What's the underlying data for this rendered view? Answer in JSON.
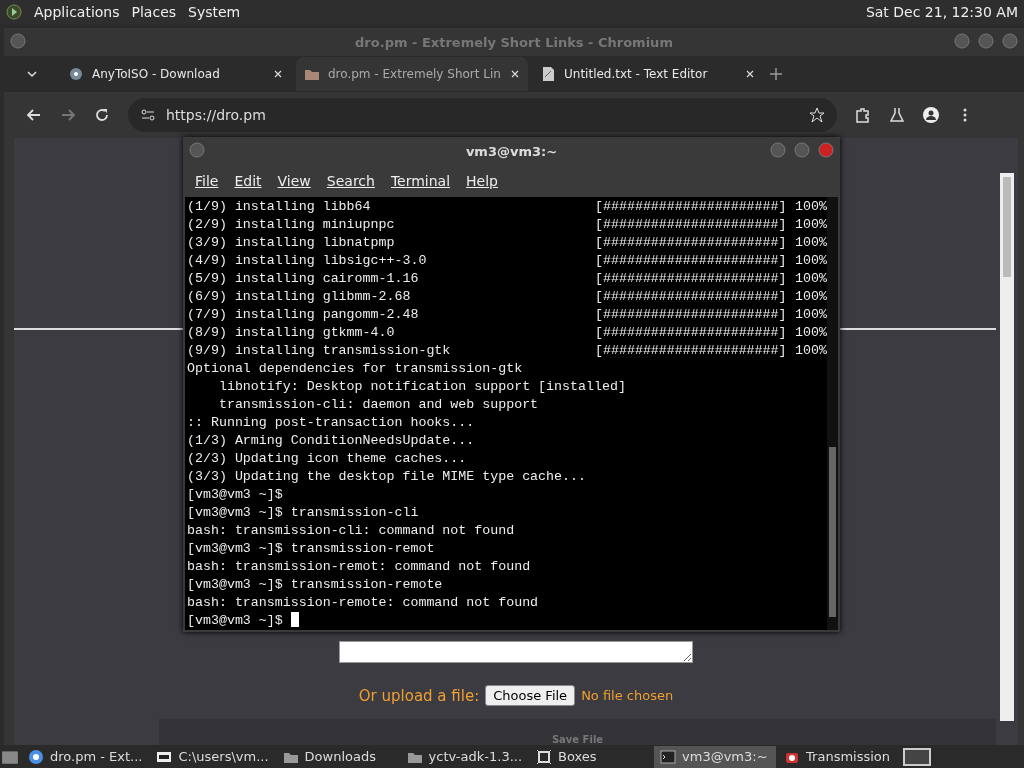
{
  "top_panel": {
    "menus": [
      "Applications",
      "Places",
      "System"
    ],
    "clock": "Sat Dec 21, 12:30 AM"
  },
  "browser": {
    "title": "dro.pm - Extremely Short Links - Chromium",
    "tabs": [
      {
        "label": "AnyToISO - Download",
        "selected": false
      },
      {
        "label": "dro.pm - Extremely Short Lin",
        "selected": true
      },
      {
        "label": "Untitled.txt - Text Editor",
        "selected": false
      }
    ],
    "url": "https://dro.pm",
    "page": {
      "upload_label": "Or upload a file:",
      "choose_button": "Choose File",
      "file_status": "No file chosen",
      "save_bar": "Save File"
    }
  },
  "terminal": {
    "title": "vm3@vm3:~",
    "menus": [
      "File",
      "Edit",
      "View",
      "Search",
      "Terminal",
      "Help"
    ],
    "lines": [
      {
        "text": "(1/9) installing libb64",
        "bar": "[######################]",
        "percent": "100%"
      },
      {
        "text": "(2/9) installing miniupnpc",
        "bar": "[######################]",
        "percent": "100%"
      },
      {
        "text": "(3/9) installing libnatpmp",
        "bar": "[######################]",
        "percent": "100%"
      },
      {
        "text": "(4/9) installing libsigc++-3.0",
        "bar": "[######################]",
        "percent": "100%"
      },
      {
        "text": "(5/9) installing cairomm-1.16",
        "bar": "[######################]",
        "percent": "100%"
      },
      {
        "text": "(6/9) installing glibmm-2.68",
        "bar": "[######################]",
        "percent": "100%"
      },
      {
        "text": "(7/9) installing pangomm-2.48",
        "bar": "[######################]",
        "percent": "100%"
      },
      {
        "text": "(8/9) installing gtkmm-4.0",
        "bar": "[######################]",
        "percent": "100%"
      },
      {
        "text": "(9/9) installing transmission-gtk",
        "bar": "[######################]",
        "percent": "100%"
      },
      {
        "text": "Optional dependencies for transmission-gtk"
      },
      {
        "text": "    libnotify: Desktop notification support [installed]"
      },
      {
        "text": "    transmission-cli: daemon and web support"
      },
      {
        "text": ":: Running post-transaction hooks..."
      },
      {
        "text": "(1/3) Arming ConditionNeedsUpdate..."
      },
      {
        "text": "(2/3) Updating icon theme caches..."
      },
      {
        "text": "(3/3) Updating the desktop file MIME type cache..."
      },
      {
        "text": "[vm3@vm3 ~]$"
      },
      {
        "text": "[vm3@vm3 ~]$ transmission-cli"
      },
      {
        "text": "bash: transmission-cli: command not found"
      },
      {
        "text": "[vm3@vm3 ~]$ transmission-remot"
      },
      {
        "text": "bash: transmission-remot: command not found"
      },
      {
        "text": "[vm3@vm3 ~]$ transmission-remote"
      },
      {
        "text": "bash: transmission-remote: command not found"
      },
      {
        "text": "[vm3@vm3 ~]$",
        "cursor": true
      }
    ]
  },
  "taskbar": [
    {
      "label": "dro.pm - Ext...",
      "kind": "browser",
      "selected": false
    },
    {
      "label": "C:\\users\\vm...",
      "kind": "zip",
      "selected": false
    },
    {
      "label": "Downloads",
      "kind": "folder",
      "selected": false
    },
    {
      "label": "yctv-adk-1.3...",
      "kind": "folder",
      "selected": false
    },
    {
      "label": "Boxes",
      "kind": "boxes",
      "selected": false
    },
    {
      "label": "vm3@vm3:~",
      "kind": "terminal",
      "selected": true
    },
    {
      "label": "Transmission",
      "kind": "transmission",
      "selected": false
    }
  ]
}
